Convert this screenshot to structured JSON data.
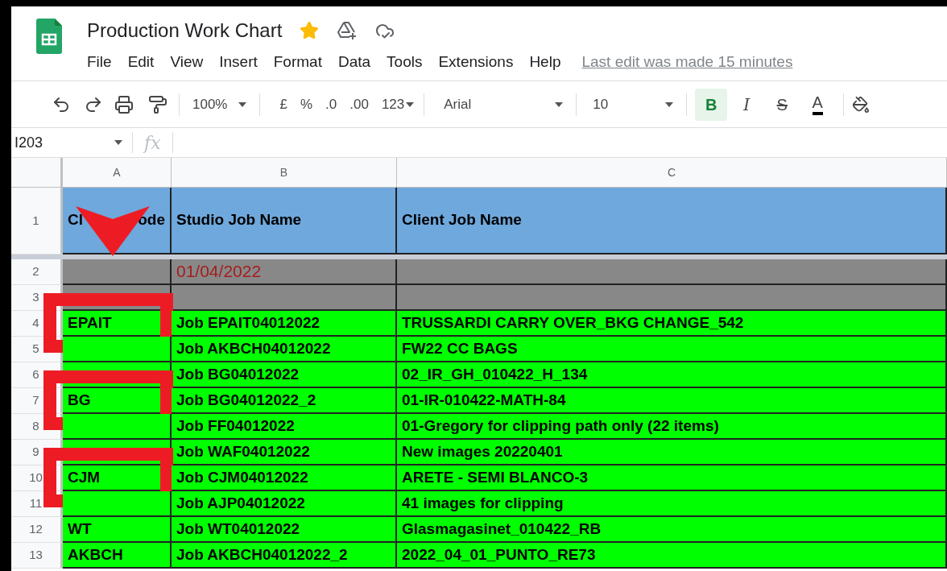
{
  "document": {
    "title": "Production Work Chart",
    "starred": true
  },
  "menu": [
    "File",
    "Edit",
    "View",
    "Insert",
    "Format",
    "Data",
    "Tools",
    "Extensions",
    "Help"
  ],
  "last_edit": "Last edit was made 15 minutes",
  "toolbar": {
    "zoom": "100%",
    "number_buttons": [
      "£",
      "%",
      ".0",
      ".00",
      "123"
    ],
    "font": "Arial",
    "font_size": "10",
    "format_buttons": [
      {
        "kind": "bold",
        "label": "B",
        "selected": true
      },
      {
        "kind": "italic",
        "label": "I",
        "selected": false
      },
      {
        "kind": "strike",
        "label": "S",
        "selected": false
      },
      {
        "kind": "color",
        "label": "A",
        "selected": false
      }
    ]
  },
  "formula_bar": {
    "cell_ref": "I203",
    "fx": "fx"
  },
  "columns": [
    "A",
    "B",
    "C"
  ],
  "rows": [
    {
      "number": "1",
      "kind": "header",
      "cells": [
        [
          "Cl",
          "ode"
        ],
        "Studio Job Name",
        "Client Job Name"
      ],
      "pointer": true,
      "marked": false
    },
    {
      "number": "2",
      "kind": "date",
      "cells": [
        "",
        "01/04/2022",
        ""
      ],
      "pointer": false,
      "marked": false
    },
    {
      "number": "3",
      "kind": "blank",
      "cells": [
        "",
        "",
        ""
      ],
      "pointer": false,
      "marked": false
    },
    {
      "number": "4",
      "kind": "job",
      "cells": [
        "EPAIT",
        "Job EPAIT04012022",
        "TRUSSARDI CARRY OVER_BKG CHANGE_542"
      ],
      "pointer": false,
      "marked": true
    },
    {
      "number": "5",
      "kind": "job",
      "cells": [
        "",
        "Job AKBCH04012022",
        "FW22 CC BAGS"
      ],
      "pointer": false,
      "marked": false
    },
    {
      "number": "6",
      "kind": "job",
      "cells": [
        "",
        "Job BG04012022",
        "02_IR_GH_010422_H_134"
      ],
      "pointer": false,
      "marked": false
    },
    {
      "number": "7",
      "kind": "job",
      "cells": [
        "BG",
        "Job BG04012022_2",
        "01-IR-010422-MATH-84"
      ],
      "pointer": false,
      "marked": true
    },
    {
      "number": "8",
      "kind": "job",
      "cells": [
        "",
        "Job FF04012022",
        "01-Gregory for clipping path only (22 items)"
      ],
      "pointer": false,
      "marked": false
    },
    {
      "number": "9",
      "kind": "job",
      "cells": [
        "",
        "Job WAF04012022",
        "New images 20220401"
      ],
      "pointer": false,
      "marked": false
    },
    {
      "number": "10",
      "kind": "job",
      "cells": [
        "CJM",
        "Job CJM04012022",
        "ARETE - SEMI BLANCO-3"
      ],
      "pointer": false,
      "marked": true
    },
    {
      "number": "11",
      "kind": "job",
      "cells": [
        "",
        "Job AJP04012022",
        "41 images for clipping"
      ],
      "pointer": false,
      "marked": false
    },
    {
      "number": "12",
      "kind": "job",
      "cells": [
        "WT",
        "Job WT04012022",
        "Glasmagasinet_010422_RB"
      ],
      "pointer": false,
      "marked": false
    },
    {
      "number": "13",
      "kind": "job",
      "cells": [
        "AKBCH",
        "Job AKBCH04012022_2",
        "2022_04_01_PUNTO_RE73"
      ],
      "pointer": false,
      "marked": false
    }
  ]
}
